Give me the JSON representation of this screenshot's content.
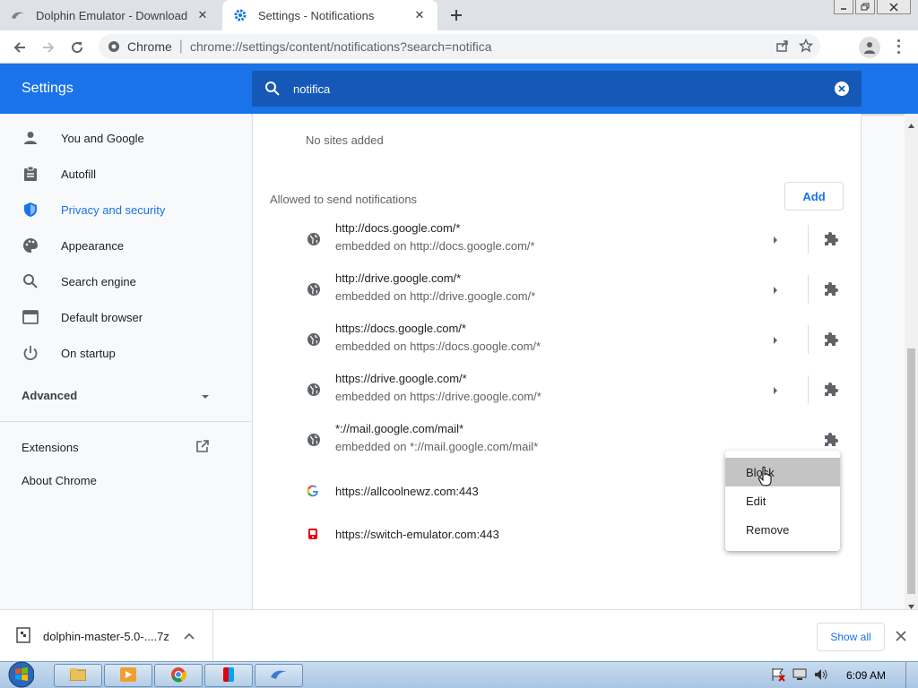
{
  "tabs": [
    {
      "title": "Dolphin Emulator - Download",
      "icon": "dolphin-icon"
    },
    {
      "title": "Settings - Notifications",
      "icon": "gear-icon"
    }
  ],
  "toolbar": {
    "site_label": "Chrome",
    "url": "chrome://settings/content/notifications?search=notifica"
  },
  "header": {
    "title": "Settings",
    "search_value": "notifica"
  },
  "sidebar": {
    "items": [
      {
        "label": "You and Google",
        "icon": "person-icon"
      },
      {
        "label": "Autofill",
        "icon": "clipboard-icon"
      },
      {
        "label": "Privacy and security",
        "icon": "shield-icon"
      },
      {
        "label": "Appearance",
        "icon": "palette-icon"
      },
      {
        "label": "Search engine",
        "icon": "search-icon"
      },
      {
        "label": "Default browser",
        "icon": "browser-icon"
      },
      {
        "label": "On startup",
        "icon": "power-icon"
      }
    ],
    "advanced": "Advanced",
    "extensions": "Extensions",
    "about": "About Chrome"
  },
  "main": {
    "no_sites": "No sites added",
    "allowed_label": "Allowed to send notifications",
    "add_label": "Add",
    "sites": [
      {
        "url": "http://docs.google.com/*",
        "sub": "embedded on http://docs.google.com/*"
      },
      {
        "url": "http://drive.google.com/*",
        "sub": "embedded on http://drive.google.com/*"
      },
      {
        "url": "https://docs.google.com/*",
        "sub": "embedded on https://docs.google.com/*"
      },
      {
        "url": "https://drive.google.com/*",
        "sub": "embedded on https://drive.google.com/*"
      },
      {
        "url": "*://mail.google.com/mail*",
        "sub": "embedded on *://mail.google.com/mail*"
      }
    ],
    "single_sites": [
      {
        "url": "https://allcoolnewz.com:443"
      },
      {
        "url": "https://switch-emulator.com:443"
      }
    ]
  },
  "context_menu": {
    "items": [
      "Block",
      "Edit",
      "Remove"
    ]
  },
  "download": {
    "filename": "dolphin-master-5.0-....7z",
    "show_all": "Show all"
  },
  "taskbar": {
    "clock": "6:09 AM"
  },
  "colors": {
    "accent": "#1a73e8",
    "header_search": "#1558b8"
  }
}
